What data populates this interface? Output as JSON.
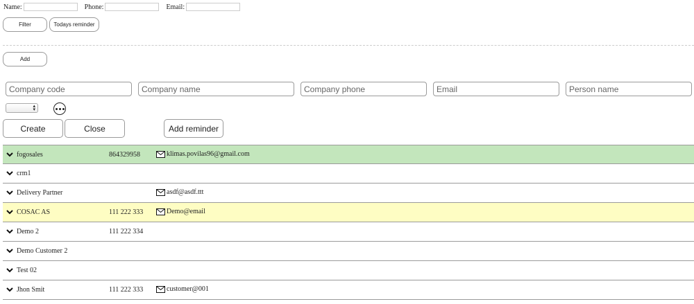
{
  "filter": {
    "name_label": "Name:",
    "phone_label": "Phone:",
    "email_label": "Email:",
    "filter_button": "Filter",
    "todays_reminder_button": "Todays reminder"
  },
  "add_button": "Add",
  "form": {
    "company_code_placeholder": "Company code",
    "company_name_placeholder": "Company name",
    "company_phone_placeholder": "Company phone",
    "email_placeholder": "Email",
    "person_name_placeholder": "Person name",
    "select_value": "",
    "create_button": "Create",
    "close_button": "Close",
    "add_reminder_button": "Add reminder"
  },
  "companies": [
    {
      "name": "fogosales",
      "phone": "864329958",
      "email": "klimas.povilas96@gmail.com",
      "highlight": "#c3e6bc"
    },
    {
      "name": "crm1",
      "phone": "",
      "email": ""
    },
    {
      "name": "Delivery Partner",
      "phone": "",
      "email": "asdf@asdf.ttt"
    },
    {
      "name": "COSAC AS",
      "phone": "111 222 333",
      "email": "Demo@email",
      "highlight": "#fefdc3"
    },
    {
      "name": "Demo 2",
      "phone": "111 222 334",
      "email": ""
    },
    {
      "name": "Demo Customer 2",
      "phone": "",
      "email": ""
    },
    {
      "name": "Test 02",
      "phone": "",
      "email": ""
    },
    {
      "name": "Jhon Smit",
      "phone": "111 222 333",
      "email": "customer@001"
    }
  ],
  "icons": {
    "expand": "chevron-down-icon",
    "email": "envelope-icon",
    "more": "more-options-icon"
  }
}
